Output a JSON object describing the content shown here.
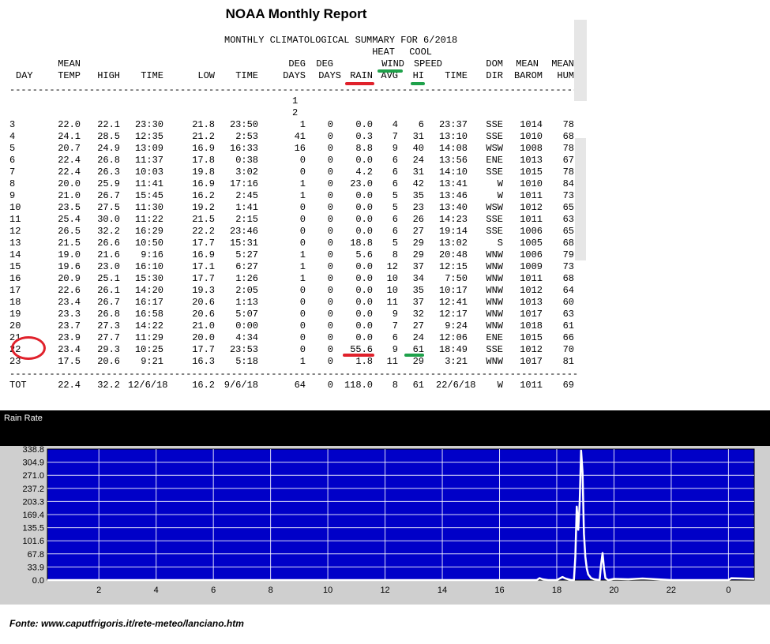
{
  "title": "NOAA Monthly Report",
  "summary_title": "MONTHLY CLIMATOLOGICAL SUMMARY FOR 6/2018",
  "header_row1": {
    "heat": "HEAT",
    "cool": "COOL"
  },
  "header_row2": {
    "mean": "MEAN",
    "deg1": "DEG",
    "deg2": "DEG",
    "wind": "WIND",
    "speed": "SPEED",
    "dom": "DOM",
    "mean2": "MEAN",
    "mean3": "MEAN"
  },
  "header_row3": {
    "day": "DAY",
    "temp": "TEMP",
    "high": "HIGH",
    "time1": "TIME",
    "low": "LOW",
    "time2": "TIME",
    "days1": "DAYS",
    "days2": "DAYS",
    "rain": "RAIN",
    "avg": "AVG",
    "hi": "HI",
    "time3": "TIME",
    "dir": "DIR",
    "barom": "BAROM",
    "hum": "HUM"
  },
  "separator": "-----------------------------------------------------------------------------------------------------",
  "partial_rows": [
    "1",
    "2"
  ],
  "rows": [
    [
      "3",
      "22.0",
      "22.1",
      "23:30",
      "21.8",
      "23:50",
      "1",
      "0",
      "0.0",
      "4",
      "6",
      "23:37",
      "SSE",
      "1014",
      "78"
    ],
    [
      "4",
      "24.1",
      "28.5",
      "12:35",
      "21.2",
      "2:53",
      "41",
      "0",
      "0.3",
      "7",
      "31",
      "13:10",
      "SSE",
      "1010",
      "68"
    ],
    [
      "5",
      "20.7",
      "24.9",
      "13:09",
      "16.9",
      "16:33",
      "16",
      "0",
      "8.8",
      "9",
      "40",
      "14:08",
      "WSW",
      "1008",
      "78"
    ],
    [
      "6",
      "22.4",
      "26.8",
      "11:37",
      "17.8",
      "0:38",
      "0",
      "0",
      "0.0",
      "6",
      "24",
      "13:56",
      "ENE",
      "1013",
      "67"
    ],
    [
      "7",
      "22.4",
      "26.3",
      "10:03",
      "19.8",
      "3:02",
      "0",
      "0",
      "4.2",
      "6",
      "31",
      "14:10",
      "SSE",
      "1015",
      "78"
    ],
    [
      "8",
      "20.0",
      "25.9",
      "11:41",
      "16.9",
      "17:16",
      "1",
      "0",
      "23.0",
      "6",
      "42",
      "13:41",
      "W",
      "1010",
      "84"
    ],
    [
      "9",
      "21.0",
      "26.7",
      "15:45",
      "16.2",
      "2:45",
      "1",
      "0",
      "0.0",
      "5",
      "35",
      "13:46",
      "W",
      "1011",
      "73"
    ],
    [
      "10",
      "23.5",
      "27.5",
      "11:30",
      "19.2",
      "1:41",
      "0",
      "0",
      "0.0",
      "5",
      "23",
      "13:40",
      "WSW",
      "1012",
      "65"
    ],
    [
      "11",
      "25.4",
      "30.0",
      "11:22",
      "21.5",
      "2:15",
      "0",
      "0",
      "0.0",
      "6",
      "26",
      "14:23",
      "SSE",
      "1011",
      "63"
    ],
    [
      "12",
      "26.5",
      "32.2",
      "16:29",
      "22.2",
      "23:46",
      "0",
      "0",
      "0.0",
      "6",
      "27",
      "19:14",
      "SSE",
      "1006",
      "65"
    ],
    [
      "13",
      "21.5",
      "26.6",
      "10:50",
      "17.7",
      "15:31",
      "0",
      "0",
      "18.8",
      "5",
      "29",
      "13:02",
      "S",
      "1005",
      "68"
    ],
    [
      "14",
      "19.0",
      "21.6",
      "9:16",
      "16.9",
      "5:27",
      "1",
      "0",
      "5.6",
      "8",
      "29",
      "20:48",
      "WNW",
      "1006",
      "79"
    ],
    [
      "15",
      "19.6",
      "23.0",
      "16:10",
      "17.1",
      "6:27",
      "1",
      "0",
      "0.0",
      "12",
      "37",
      "12:15",
      "WNW",
      "1009",
      "73"
    ],
    [
      "16",
      "20.9",
      "25.1",
      "15:30",
      "17.7",
      "1:26",
      "1",
      "0",
      "0.0",
      "10",
      "34",
      "7:50",
      "WNW",
      "1011",
      "68"
    ],
    [
      "17",
      "22.6",
      "26.1",
      "14:20",
      "19.3",
      "2:05",
      "0",
      "0",
      "0.0",
      "10",
      "35",
      "10:17",
      "WNW",
      "1012",
      "64"
    ],
    [
      "18",
      "23.4",
      "26.7",
      "16:17",
      "20.6",
      "1:13",
      "0",
      "0",
      "0.0",
      "11",
      "37",
      "12:41",
      "WNW",
      "1013",
      "60"
    ],
    [
      "19",
      "23.3",
      "26.8",
      "16:58",
      "20.6",
      "5:07",
      "0",
      "0",
      "0.0",
      "9",
      "32",
      "12:17",
      "WNW",
      "1017",
      "63"
    ],
    [
      "20",
      "23.7",
      "27.3",
      "14:22",
      "21.0",
      "0:00",
      "0",
      "0",
      "0.0",
      "7",
      "27",
      "9:24",
      "WNW",
      "1018",
      "61"
    ],
    [
      "21",
      "23.9",
      "27.7",
      "11:29",
      "20.0",
      "4:34",
      "0",
      "0",
      "0.0",
      "6",
      "24",
      "12:06",
      "ENE",
      "1015",
      "66"
    ],
    [
      "22",
      "23.4",
      "29.3",
      "10:25",
      "17.7",
      "23:53",
      "0",
      "0",
      "55.6",
      "9",
      "61",
      "18:49",
      "SSE",
      "1012",
      "70"
    ],
    [
      "23",
      "17.5",
      "20.6",
      "9:21",
      "16.3",
      "5:18",
      "1",
      "0",
      "1.8",
      "11",
      "29",
      "3:21",
      "WNW",
      "1017",
      "81"
    ]
  ],
  "total_row": [
    "TOT",
    "22.4",
    "32.2",
    "12/6/18",
    "16.2",
    "9/6/18",
    "64",
    "0",
    "118.0",
    "8",
    "61",
    "22/6/18",
    "W",
    "1011",
    "69"
  ],
  "rain_panel_title": "Rain Rate",
  "source": "Fonte: www.caputfrigoris.it/rete-meteo/lanciano.htm",
  "colors": {
    "plot_bg": "#0000c8",
    "line": "#ffffff",
    "grid": "#ffffff",
    "highlight_red": "#e0212b",
    "highlight_green": "#1ea14a"
  },
  "chart_data": {
    "type": "line",
    "title": "Rain Rate",
    "ylim": [
      0.0,
      338.8
    ],
    "yticks": [
      "0.0",
      "33.9",
      "67.8",
      "101.6",
      "135.5",
      "169.4",
      "203.3",
      "237.2",
      "271.0",
      "304.9",
      "338.8"
    ],
    "xlim": [
      0.2,
      24.9
    ],
    "xticks": [
      2,
      4,
      6,
      8,
      10,
      12,
      14,
      16,
      18,
      20,
      22,
      24
    ],
    "xtick_labels": [
      "2",
      "4",
      "6",
      "8",
      "10",
      "12",
      "14",
      "16",
      "18",
      "20",
      "22",
      "0"
    ],
    "grid": true,
    "series": [
      {
        "x": [
          0.2,
          17.3,
          17.4,
          17.5,
          17.7,
          18.0,
          18.2,
          18.3,
          18.5,
          18.6,
          18.65,
          18.7,
          18.75,
          18.8,
          18.85,
          18.9,
          18.95,
          19.0,
          19.05,
          19.1,
          19.2,
          19.3,
          19.5,
          19.55,
          19.6,
          19.65,
          19.7,
          19.8,
          20.0,
          20.5,
          21.0,
          21.5,
          22.0,
          23.0,
          24.0,
          24.1,
          24.5,
          24.9
        ],
        "y": [
          0,
          0,
          5,
          2,
          0,
          0,
          8,
          4,
          0,
          0,
          60,
          190,
          130,
          200,
          335,
          280,
          120,
          60,
          30,
          15,
          5,
          2,
          0,
          40,
          70,
          30,
          5,
          0,
          3,
          2,
          4,
          2,
          0,
          0,
          0,
          5,
          4,
          3
        ]
      }
    ]
  }
}
